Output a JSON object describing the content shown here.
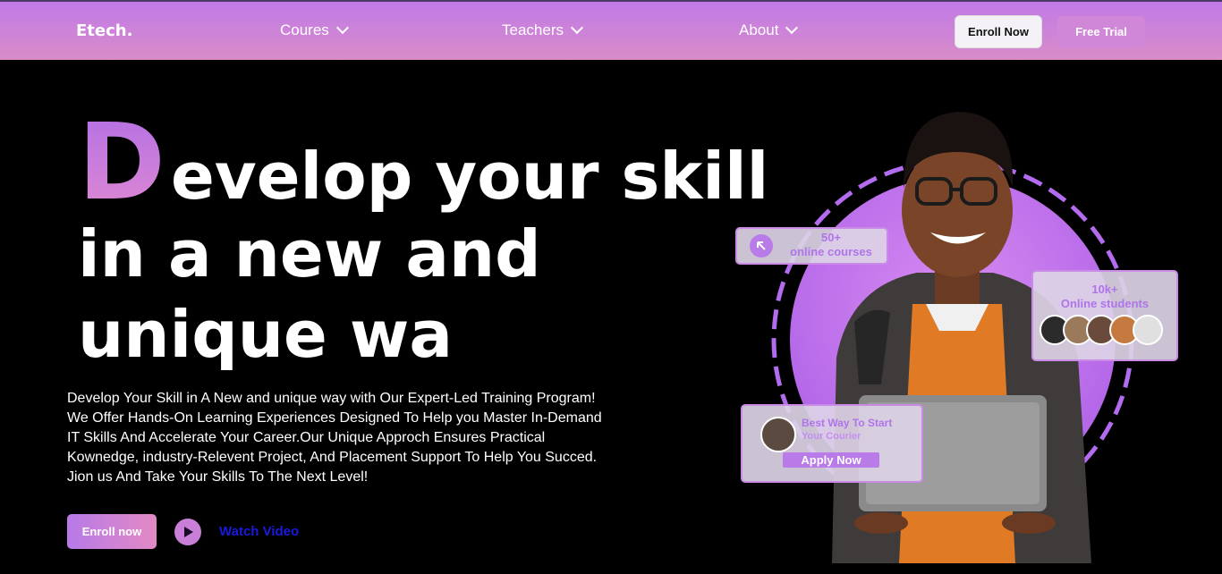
{
  "nav": {
    "brand": "Etech.",
    "items": [
      {
        "label": "Coures"
      },
      {
        "label": "Teachers"
      },
      {
        "label": "About"
      }
    ],
    "enroll_label": "Enroll Now",
    "trial_label": "Free Trial"
  },
  "hero": {
    "first_letter": "D",
    "line1_rest": "evelop your skill",
    "line2": "in a new and",
    "line3": "unique wa",
    "description": [
      "Develop Your Skill in A New and unique way with Our Expert-Led Training Program!",
      "We Offer Hands-On Learning Experiences Designed To Help you Master In-Demand",
      "IT Skills And Accelerate Your Career.Our Unique Approch Ensures Practical",
      "Kownedge, industry-Relevent Project, And Placement Support To Help You Succed.",
      "Jion us And Take Your Skills To The Next Level!"
    ],
    "enroll_label": "Enroll now",
    "watch_label": "Watch Video"
  },
  "cards": {
    "courses_count": "50+",
    "courses_label": "online courses",
    "students_count": "10k+",
    "students_label": "Online students",
    "start_title": "Best Way To Start",
    "start_sub": "Your Courier",
    "apply_label": "Apply Now"
  },
  "colors": {
    "accent": "#b77ae8",
    "accent_pink": "#e38ac4",
    "watch_link": "#1a1adc",
    "background": "#000000"
  }
}
